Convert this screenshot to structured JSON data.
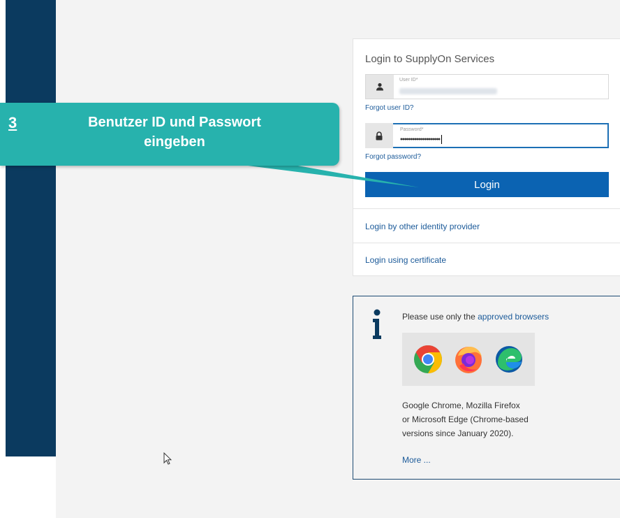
{
  "callout": {
    "step": "3",
    "text": "Benutzer ID und Passwort eingeben"
  },
  "login": {
    "title": "Login to SupplyOn Services",
    "user_label": "User ID*",
    "forgot_user": "Forgot user ID?",
    "password_label": "Password*",
    "password_value": "••••••••••••••••••••",
    "forgot_password": "Forgot password?",
    "login_button": "Login",
    "other_idp": "Login by other identity provider",
    "certificate": "Login using certificate"
  },
  "info": {
    "text_prefix": "Please use only the",
    "link": "approved browsers",
    "browsers_line1": "Google Chrome, Mozilla Firefox",
    "browsers_line2": "or Microsoft Edge (Chrome-based",
    "browsers_line3": "versions since January 2020).",
    "more": "More ..."
  },
  "icons": [
    "user-icon",
    "lock-icon",
    "info-icon",
    "chrome-icon",
    "firefox-icon",
    "edge-icon",
    "cursor-icon"
  ],
  "colors": {
    "sidebar": "#0b3a5f",
    "primary": "#0b63b2",
    "callout": "#27b2ad",
    "link": "#1b5a99"
  }
}
